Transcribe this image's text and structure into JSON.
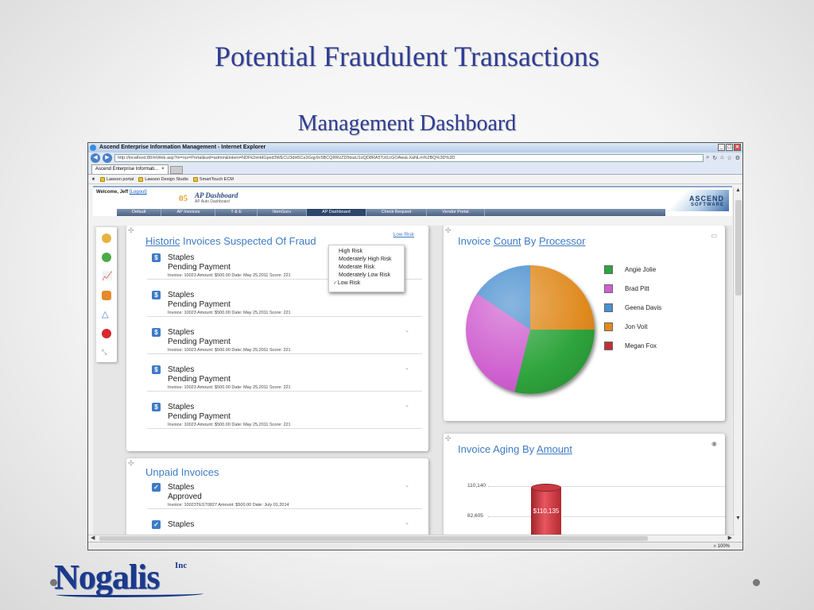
{
  "slide": {
    "title": "Potential Fraudulent Transactions",
    "subtitle": "Management Dashboard",
    "logo": "Nogalis",
    "logo_suffix": "Inc"
  },
  "browser": {
    "window_title": "Ascend Enterprise Information Management - Internet Explorer",
    "address": "http://localhost:80/mWeb.asp?m=rss=Portal&uid=admin&token=NDFk2eHdGpxd3WECU3dH5Ce3Gqy9c5BCQRRzZD5tsaU1sQD8RA5Tzt1cGOAwaLXaNLm%2BQ%3D%3D",
    "address_display": "http://localhost:80/mWeb.asp?m=rss=Portal&uid=admin&token=NDFk2eHdGpxd3WECU3dH5Ce3Gqy9c5BCQRRzZD5tsaU1sQD8RA5Tzt1cGOAwaLXaNLm%2BQ%3D%3D",
    "tab_label": "Ascend Enterprise Informati...",
    "favorites": [
      "Lawson portal",
      "Lawson Design Studio",
      "SmartTouch ECM"
    ],
    "zoom": "100%"
  },
  "app": {
    "welcome": "Welcome, Jeff",
    "logout": "[Logout]",
    "number": "05",
    "title": "AP Dashboard",
    "subtitle": "AP Auto Dashboard",
    "brand": "ASCEND",
    "brand_sub": "SOFTWARE",
    "nav": [
      "Default",
      "AP Invoices",
      "T & E",
      "ItemGuru",
      "AP Dashboard",
      "Check Request",
      "Vendor Portal"
    ]
  },
  "historic": {
    "title_a": "Historic",
    "title_b": "Invoices Suspected Of Fraud",
    "filter_link": "Low Risk",
    "risk_options": [
      "High Risk",
      "Moderately High Risk",
      "Moderate Risk",
      "Moderately Low Risk",
      "Low Risk"
    ],
    "selected_risk": "Low Risk",
    "items": [
      {
        "badge": "$",
        "vendor": "Staples",
        "status": "Pending Payment",
        "meta": "Invoice: 10023   Amount: $500.00   Date: May 25,2011   Score: 221"
      },
      {
        "badge": "$",
        "vendor": "Staples",
        "status": "Pending Payment",
        "meta": "Invoice: 10023   Amount: $500.00   Date: May 25,2011   Score: 221"
      },
      {
        "badge": "$",
        "vendor": "Staples",
        "status": "Pending Payment",
        "meta": "Invoice: 10023   Amount: $500.00   Date: May 25,2011   Score: 221"
      },
      {
        "badge": "$",
        "vendor": "Staples",
        "status": "Pending Payment",
        "meta": "Invoice: 10023   Amount: $500.00   Date: May 25,2011   Score: 221"
      },
      {
        "badge": "$",
        "vendor": "Staples",
        "status": "Pending Payment",
        "meta": "Invoice: 10023   Amount: $500.00   Date: May 25,2011   Score: 221"
      }
    ]
  },
  "unpaid": {
    "title": "Unpaid Invoices",
    "items": [
      {
        "badge": "✓",
        "vendor": "Staples",
        "status": "Approved",
        "meta": "Invoice: 10023TEST0827   Amount: $500.00   Date: July 01,2014"
      },
      {
        "badge": "✓",
        "vendor": "Staples",
        "status": "",
        "meta": ""
      }
    ]
  },
  "invoice_count": {
    "title_a": "Invoice",
    "title_b": "Count",
    "title_c": "By",
    "title_d": "Processor",
    "chart_data": {
      "type": "pie",
      "slices": [
        {
          "name": "Jon Voit",
          "value": 25,
          "color": "#e08a1e"
        },
        {
          "name": "Angie Jolie",
          "value": 29,
          "color": "#2ea43c"
        },
        {
          "name": "Brad Pitt",
          "value": 30,
          "color": "#cf5fcf"
        },
        {
          "name": "Geena Davis",
          "value": 16,
          "color": "#4a8fcf"
        }
      ],
      "legend": [
        {
          "name": "Angie Jolie",
          "color": "#2ea43c"
        },
        {
          "name": "Brad Pitt",
          "color": "#cf5fcf"
        },
        {
          "name": "Geena Davis",
          "color": "#4a8fcf"
        },
        {
          "name": "Jon Voit",
          "color": "#e08a1e"
        },
        {
          "name": "Megan Fox",
          "color": "#c0303a"
        }
      ],
      "legend_position": "right"
    }
  },
  "aging": {
    "title_a": "Invoice Aging By",
    "title_b": "Amount",
    "chart_data": {
      "type": "bar",
      "ticks": [
        "110,140",
        "82,605"
      ],
      "bar_label": "$110,135",
      "values": [
        110135
      ]
    }
  },
  "icons": {
    "sidebar": [
      "user-icon",
      "refresh-icon",
      "chart-icon",
      "thumb-icon",
      "triangle-icon",
      "stop-icon",
      "expand-icon"
    ]
  }
}
